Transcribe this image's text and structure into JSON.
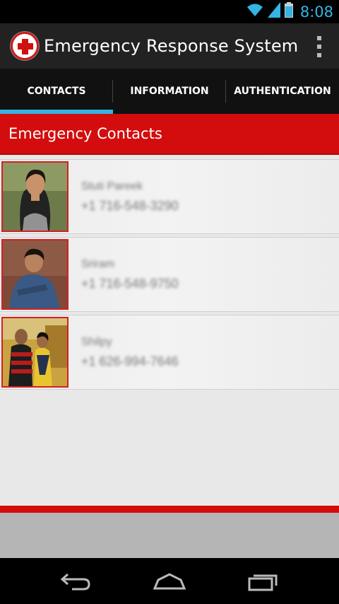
{
  "status_bar": {
    "time": "8:08",
    "icons": [
      "wifi-icon",
      "signal-icon",
      "battery-icon"
    ],
    "accent_color": "#33b5e5"
  },
  "action_bar": {
    "title": "Emergency Response System",
    "logo_icon": "red-cross-icon",
    "overflow_icon": "overflow-menu-icon"
  },
  "tabs": [
    {
      "label": "CONTACTS",
      "active": true
    },
    {
      "label": "INFORMATION",
      "active": false
    },
    {
      "label": "AUTHENTICATION",
      "active": false
    }
  ],
  "section": {
    "title": "Emergency Contacts",
    "color": "#d30d0d"
  },
  "contacts": [
    {
      "name": "Stuti Pareek",
      "phone": "+1 716-548-3290"
    },
    {
      "name": "Sriram",
      "phone": "+1 716-548-9750"
    },
    {
      "name": "Shilpy",
      "phone": "+1 626-994-7646"
    }
  ],
  "nav_bar": {
    "buttons": [
      "back-icon",
      "home-icon",
      "recent-apps-icon"
    ]
  }
}
